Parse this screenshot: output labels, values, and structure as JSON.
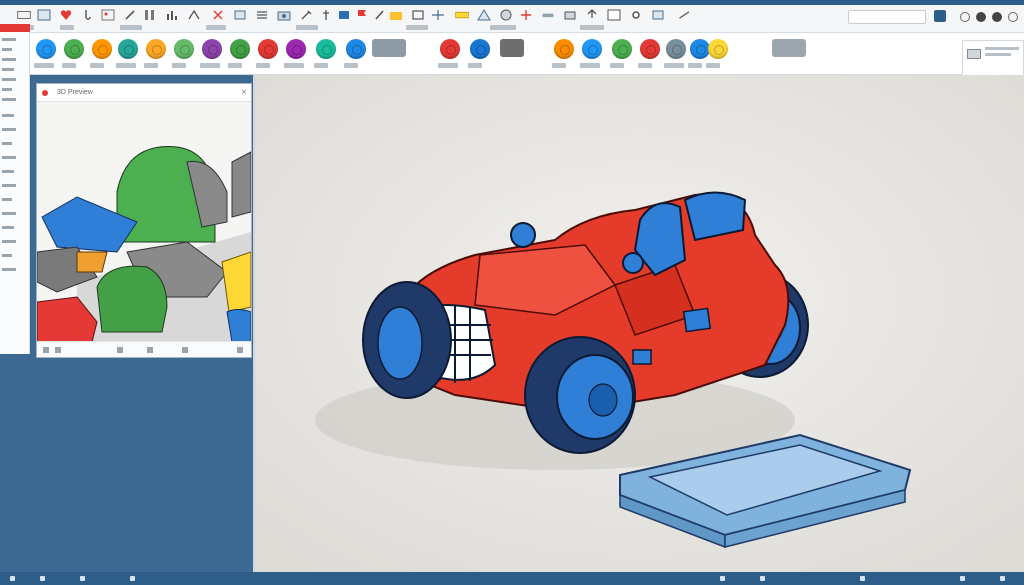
{
  "search": {
    "placeholder": ""
  },
  "inspector": {
    "title": "3D Preview",
    "close": "×"
  },
  "colors": {
    "accent": "#2f5d8a",
    "viewport_bg": "#e8e6e2",
    "car_red": "#e53b2b",
    "wheel_blue": "#2f7fd6",
    "tire_navy": "#1f3a68",
    "tray_blue": "#7fb3dd"
  },
  "palette": [
    {
      "name": "blue",
      "color": "#2196f3"
    },
    {
      "name": "green",
      "color": "#4caf50"
    },
    {
      "name": "orange",
      "color": "#ff9800"
    },
    {
      "name": "teal",
      "color": "#26a69a"
    },
    {
      "name": "orange-2",
      "color": "#ffa726"
    },
    {
      "name": "green-2",
      "color": "#66bb6a"
    },
    {
      "name": "purple",
      "color": "#8e44ad"
    },
    {
      "name": "green-3",
      "color": "#43a047"
    },
    {
      "name": "red",
      "color": "#e53935"
    },
    {
      "name": "violet",
      "color": "#9c27b0"
    },
    {
      "name": "teal-2",
      "color": "#1abc9c"
    },
    {
      "name": "blue-2",
      "color": "#1e88e5"
    },
    {
      "name": "red-2",
      "color": "#e53935"
    },
    {
      "name": "blue-3",
      "color": "#1976d2"
    },
    {
      "name": "orange-3",
      "color": "#fb8c00"
    },
    {
      "name": "blue-4",
      "color": "#2196f3"
    },
    {
      "name": "green-4",
      "color": "#4caf50"
    },
    {
      "name": "red-3",
      "color": "#e53935"
    },
    {
      "name": "grey",
      "color": "#78909c"
    },
    {
      "name": "blue-5",
      "color": "#1e88e5"
    },
    {
      "name": "yellow",
      "color": "#fdd835"
    }
  ]
}
